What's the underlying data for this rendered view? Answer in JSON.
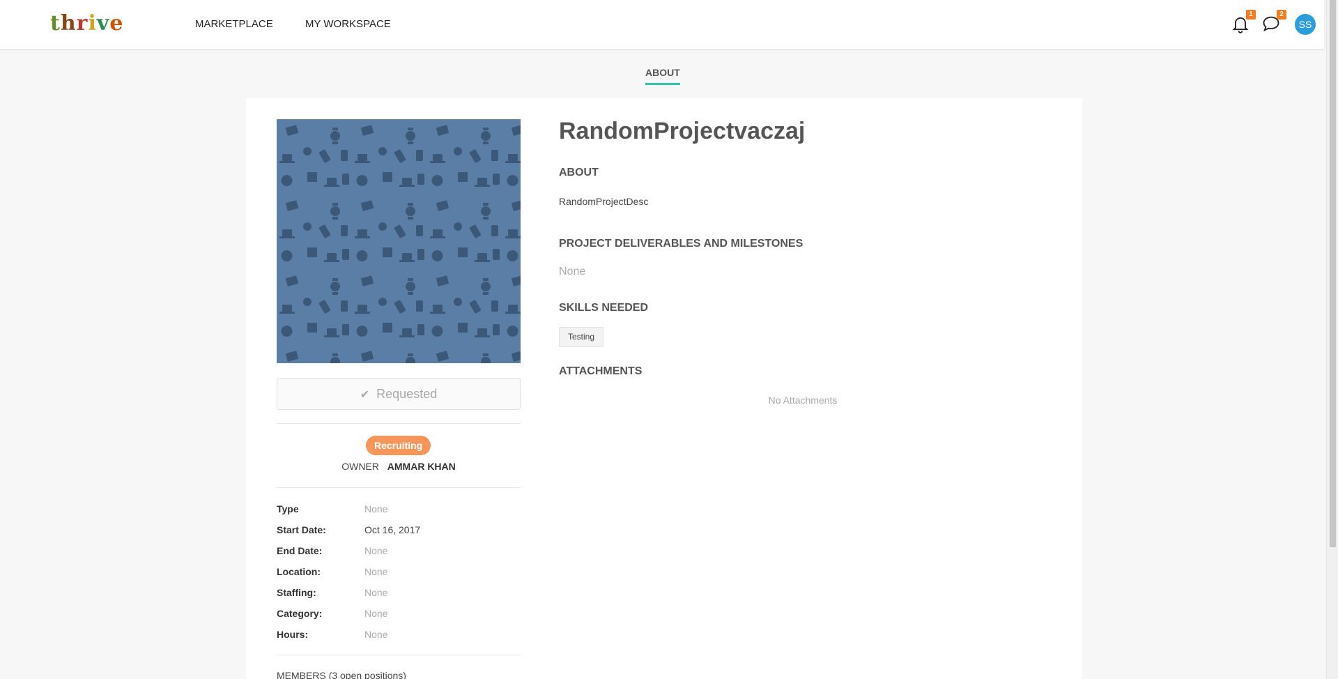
{
  "nav": {
    "logo": "thrive",
    "marketplace": "MARKETPLACE",
    "workspace": "MY WORKSPACE",
    "notifications_count": "1",
    "messages_count": "2",
    "avatar_initials": "SS"
  },
  "tabs": {
    "about": "ABOUT"
  },
  "project": {
    "title": "RandomProjectvaczaj",
    "request_label": "Requested",
    "status": "Recruiting",
    "owner_label": "OWNER",
    "owner_name": "AMMAR KHAN",
    "meta": [
      {
        "key": "Type",
        "value": "None"
      },
      {
        "key": "Start Date:",
        "value": "Oct 16, 2017"
      },
      {
        "key": "End Date:",
        "value": "None"
      },
      {
        "key": "Location:",
        "value": "None"
      },
      {
        "key": "Staffing:",
        "value": "None"
      },
      {
        "key": "Category:",
        "value": "None"
      },
      {
        "key": "Hours:",
        "value": "None"
      }
    ],
    "members_label": "MEMBERS (3 open positions)"
  },
  "sections": {
    "about_heading": "ABOUT",
    "about_text": "RandomProjectDesc",
    "deliverables_heading": "PROJECT DELIVERABLES AND MILESTONES",
    "deliverables_text": "None",
    "skills_heading": "SKILLS NEEDED",
    "skills": [
      "Testing"
    ],
    "attachments_heading": "ATTACHMENTS",
    "attachments_text": "No Attachments"
  },
  "colors": {
    "accent": "#2dc6a8",
    "status": "#f7965a",
    "badge": "#f47b20",
    "avatar": "#2d9cdb",
    "project_image": "#5b7ea6"
  }
}
